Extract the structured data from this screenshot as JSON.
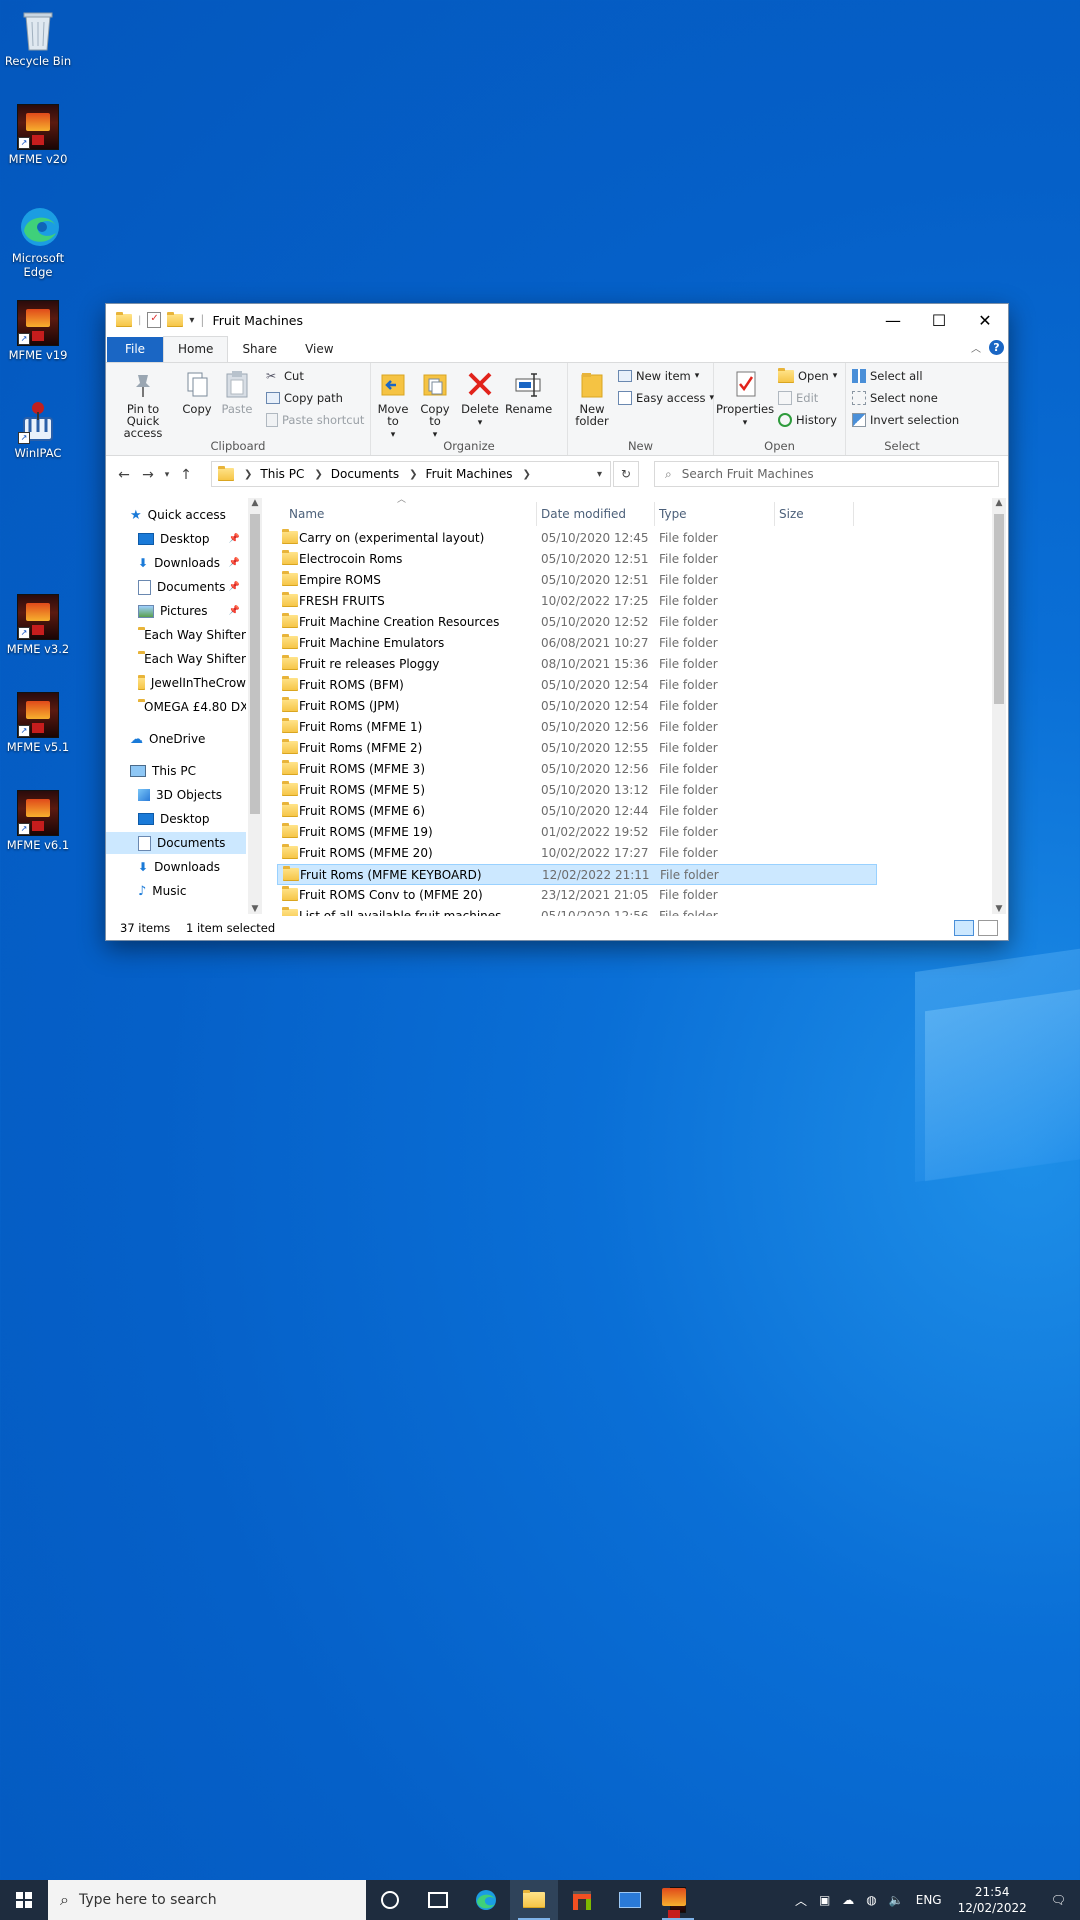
{
  "desktop": {
    "icons": [
      {
        "label": "Recycle Bin"
      },
      {
        "label": "MFME v20"
      },
      {
        "label": "Microsoft Edge"
      },
      {
        "label": "MFME v19"
      },
      {
        "label": "WinIPAC"
      },
      {
        "label": "MFME v3.2"
      },
      {
        "label": "MFME v5.1"
      },
      {
        "label": "MFME v6.1"
      }
    ]
  },
  "window": {
    "title": "Fruit Machines",
    "tabs": {
      "file": "File",
      "home": "Home",
      "share": "Share",
      "view": "View"
    },
    "ribbon": {
      "clipboard": {
        "label": "Clipboard",
        "pin": "Pin to Quick access",
        "copy": "Copy",
        "paste": "Paste",
        "cut": "Cut",
        "copy_path": "Copy path",
        "paste_shortcut": "Paste shortcut"
      },
      "organize": {
        "label": "Organize",
        "move_to": "Move to",
        "copy_to": "Copy to",
        "delete": "Delete",
        "rename": "Rename"
      },
      "new": {
        "label": "New",
        "new_folder": "New folder",
        "new_item": "New item",
        "easy_access": "Easy access"
      },
      "open": {
        "label": "Open",
        "properties": "Properties",
        "open": "Open",
        "edit": "Edit",
        "history": "History"
      },
      "select": {
        "label": "Select",
        "select_all": "Select all",
        "select_none": "Select none",
        "invert": "Invert selection"
      }
    },
    "address": {
      "crumbs": [
        "This PC",
        "Documents",
        "Fruit Machines"
      ],
      "search_placeholder": "Search Fruit Machines"
    },
    "navpane": {
      "quick_access": "Quick access",
      "items": [
        {
          "label": "Desktop",
          "pinned": true
        },
        {
          "label": "Downloads",
          "pinned": true
        },
        {
          "label": "Documents",
          "pinned": true
        },
        {
          "label": "Pictures",
          "pinned": true
        },
        {
          "label": "Each Way Shifter"
        },
        {
          "label": "Each Way Shifter"
        },
        {
          "label": "JewelInTheCrow"
        },
        {
          "label": "OMEGA £4.80 DX"
        }
      ],
      "onedrive": "OneDrive",
      "this_pc": "This PC",
      "pc_items": [
        "3D Objects",
        "Desktop",
        "Documents",
        "Downloads",
        "Music"
      ]
    },
    "columns": {
      "name": "Name",
      "date": "Date modified",
      "type": "Type",
      "size": "Size"
    },
    "files": [
      {
        "name": "Carry on (experimental layout)",
        "date": "05/10/2020 12:45",
        "type": "File folder"
      },
      {
        "name": "Electrocoin Roms",
        "date": "05/10/2020 12:51",
        "type": "File folder"
      },
      {
        "name": "Empire ROMS",
        "date": "05/10/2020 12:51",
        "type": "File folder"
      },
      {
        "name": "FRESH FRUITS",
        "date": "10/02/2022 17:25",
        "type": "File folder"
      },
      {
        "name": "Fruit Machine Creation Resources",
        "date": "05/10/2020 12:52",
        "type": "File folder"
      },
      {
        "name": "Fruit Machine Emulators",
        "date": "06/08/2021 10:27",
        "type": "File folder"
      },
      {
        "name": "Fruit re releases Ploggy",
        "date": "08/10/2021 15:36",
        "type": "File folder"
      },
      {
        "name": "Fruit ROMS (BFM)",
        "date": "05/10/2020 12:54",
        "type": "File folder"
      },
      {
        "name": "Fruit ROMS (JPM)",
        "date": "05/10/2020 12:54",
        "type": "File folder"
      },
      {
        "name": "Fruit Roms (MFME 1)",
        "date": "05/10/2020 12:56",
        "type": "File folder"
      },
      {
        "name": "Fruit Roms (MFME 2)",
        "date": "05/10/2020 12:55",
        "type": "File folder"
      },
      {
        "name": "Fruit ROMS (MFME 3)",
        "date": "05/10/2020 12:56",
        "type": "File folder"
      },
      {
        "name": "Fruit ROMS (MFME 5)",
        "date": "05/10/2020 13:12",
        "type": "File folder"
      },
      {
        "name": "Fruit ROMS (MFME 6)",
        "date": "05/10/2020 12:44",
        "type": "File folder"
      },
      {
        "name": "Fruit ROMS (MFME 19)",
        "date": "01/02/2022 19:52",
        "type": "File folder"
      },
      {
        "name": "Fruit ROMS (MFME 20)",
        "date": "10/02/2022 17:27",
        "type": "File folder"
      },
      {
        "name": "Fruit Roms (MFME KEYBOARD)",
        "date": "12/02/2022 21:11",
        "type": "File folder",
        "selected": true
      },
      {
        "name": "Fruit ROMS Conv to (MFME 20)",
        "date": "23/12/2021 21:05",
        "type": "File folder"
      },
      {
        "name": "List of all available fruit machines",
        "date": "05/10/2020 12:56",
        "type": "File folder"
      }
    ],
    "status": {
      "count": "37 items",
      "selected": "1 item selected"
    }
  },
  "taskbar": {
    "search_placeholder": "Type here to search",
    "lang": "ENG",
    "time": "21:54",
    "date": "12/02/2022"
  },
  "colors": {
    "accent": "#1a66c4",
    "selection": "#cce8ff",
    "taskbar": "#1e2c3e"
  }
}
